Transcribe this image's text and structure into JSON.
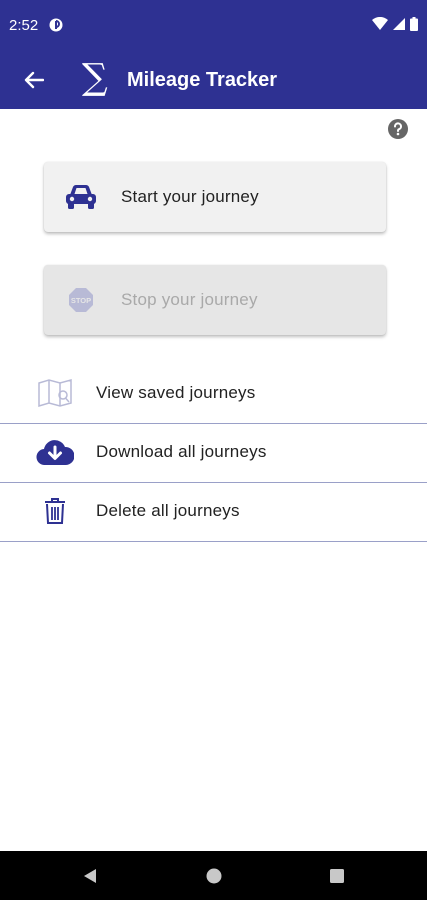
{
  "status_bar": {
    "time": "2:52",
    "icons": [
      "wifi-icon",
      "signal-icon",
      "battery-icon"
    ]
  },
  "app_bar": {
    "title": "Mileage Tracker",
    "logo_glyph": "∑",
    "back_icon": "arrow-back-icon"
  },
  "help_icon": "help-circle-icon",
  "actions": {
    "start_label": "Start your journey",
    "stop_label": "Stop your journey"
  },
  "menu": {
    "items": [
      {
        "label": "View saved journeys",
        "icon": "map-icon"
      },
      {
        "label": "Download all journeys",
        "icon": "cloud-download-icon"
      },
      {
        "label": "Delete all journeys",
        "icon": "trash-icon"
      }
    ]
  },
  "colors": {
    "primary": "#2e3192",
    "card_bg": "#f1f1f1",
    "disabled_text": "#a9a9a9"
  }
}
